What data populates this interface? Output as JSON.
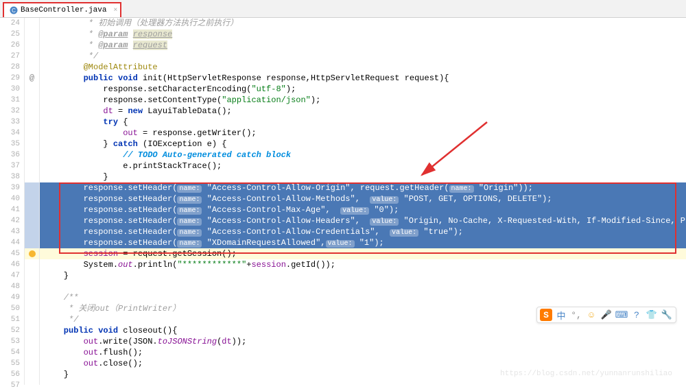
{
  "tab": {
    "filename": "BaseController.java",
    "close": "×"
  },
  "lines": {
    "start": 24,
    "end": 57
  },
  "code": {
    "l24": "         * 初始调用（处理器方法执行之前执行）",
    "l25_a": "         * ",
    "l25_b": "@param",
    "l25_c": " ",
    "l25_d": "response",
    "l26_a": "         * ",
    "l26_b": "@param",
    "l26_c": " ",
    "l26_d": "request",
    "l27": "         */",
    "l28": "        @ModelAttribute",
    "l29_a": "        public void",
    "l29_b": " init(HttpServletResponse response,HttpServletRequest request){",
    "l30_a": "            response.setCharacterEncoding(",
    "l30_b": "\"utf-8\"",
    "l30_c": ");",
    "l31_a": "            response.setContentType(",
    "l31_b": "\"application/json\"",
    "l31_c": ");",
    "l32_a": "            ",
    "l32_b": "dt",
    "l32_c": " = ",
    "l32_d": "new",
    "l32_e": " LayuiTableData();",
    "l33_a": "            ",
    "l33_b": "try",
    "l33_c": " {",
    "l34_a": "                ",
    "l34_b": "out",
    "l34_c": " = response.getWriter();",
    "l35_a": "            } ",
    "l35_b": "catch",
    "l35_c": " (IOException e) {",
    "l36_a": "                ",
    "l36_b": "// TODO Auto-generated catch block",
    "l37": "                e.printStackTrace();",
    "l38": "            }",
    "l39_a": "        response.setHeader(",
    "l39_h1": "name:",
    "l39_b": " ",
    "l39_s1": "\"Access-Control-Allow-Origin\"",
    "l39_c": ", request.getHeader(",
    "l39_h2": "name:",
    "l39_d": " ",
    "l39_s2": "\"Origin\"",
    "l39_e": "));",
    "l40_a": "        response.setHeader(",
    "l40_h1": "name:",
    "l40_b": " ",
    "l40_s1": "\"Access-Control-Allow-Methods\"",
    "l40_c": ",  ",
    "l40_h2": "value:",
    "l40_d": " ",
    "l40_s2": "\"POST, GET, OPTIONS, DELETE\"",
    "l40_e": ");",
    "l41_a": "        response.setHeader(",
    "l41_h1": "name:",
    "l41_b": " ",
    "l41_s1": "\"Access-Control-Max-Age\"",
    "l41_c": ",  ",
    "l41_h2": "value:",
    "l41_d": " ",
    "l41_s2": "\"0\"",
    "l41_e": ");",
    "l42_a": "        response.setHeader(",
    "l42_h1": "name:",
    "l42_b": " ",
    "l42_s1": "\"Access-Control-Allow-Headers\"",
    "l42_c": ",  ",
    "l42_h2": "value:",
    "l42_d": " ",
    "l42_s2": "\"Origin, No-Cache, X-Requested-With, If-Modified-Since, Pragma, Last-Modified, Cache-Co",
    "l42_e": "",
    "l43_a": "        response.setHeader(",
    "l43_h1": "name:",
    "l43_b": " ",
    "l43_s1": "\"Access-Control-Allow-Credentials\"",
    "l43_c": ",  ",
    "l43_h2": "value:",
    "l43_d": " ",
    "l43_s2": "\"true\"",
    "l43_e": ");",
    "l44_a": "        response.setHeader(",
    "l44_h1": "name:",
    "l44_b": " ",
    "l44_s1": "\"XDomainRequestAllowed\"",
    "l44_c": ",",
    "l44_h2": "value:",
    "l44_d": " ",
    "l44_s2": "\"1\"",
    "l44_e": ");",
    "l45_a": "        ",
    "l45_b": "session",
    "l45_c": " = request.getSession();",
    "l46_a": "        System.",
    "l46_b": "out",
    "l46_c": ".println(",
    "l46_s": "\"************\"",
    "l46_d": "+",
    "l46_e": "session",
    "l46_f": ".getId());",
    "l47": "    }",
    "l48": "",
    "l49": "    /**",
    "l50": "     * 关闭out（PrintWriter）",
    "l51": "     */",
    "l52_a": "    public void",
    "l52_b": " closeout(){",
    "l53_a": "        ",
    "l53_b": "out",
    "l53_c": ".write(JSON.",
    "l53_d": "toJSONString",
    "l53_e": "(",
    "l53_f": "dt",
    "l53_g": "));",
    "l54_a": "        ",
    "l54_b": "out",
    "l54_c": ".flush();",
    "l55_a": "        ",
    "l55_b": "out",
    "l55_c": ".close();",
    "l56": "    }"
  },
  "marker": {
    "at": "@"
  },
  "ime": {
    "sogou": "S",
    "lang": "中",
    "punct": "°,",
    "emoji": "☺",
    "mic": "🎤",
    "kb": "⌨",
    "help": "?",
    "skin": "👕",
    "tool": "🔧"
  },
  "watermark": "https://blog.csdn.net/yunnanrunshiliao"
}
